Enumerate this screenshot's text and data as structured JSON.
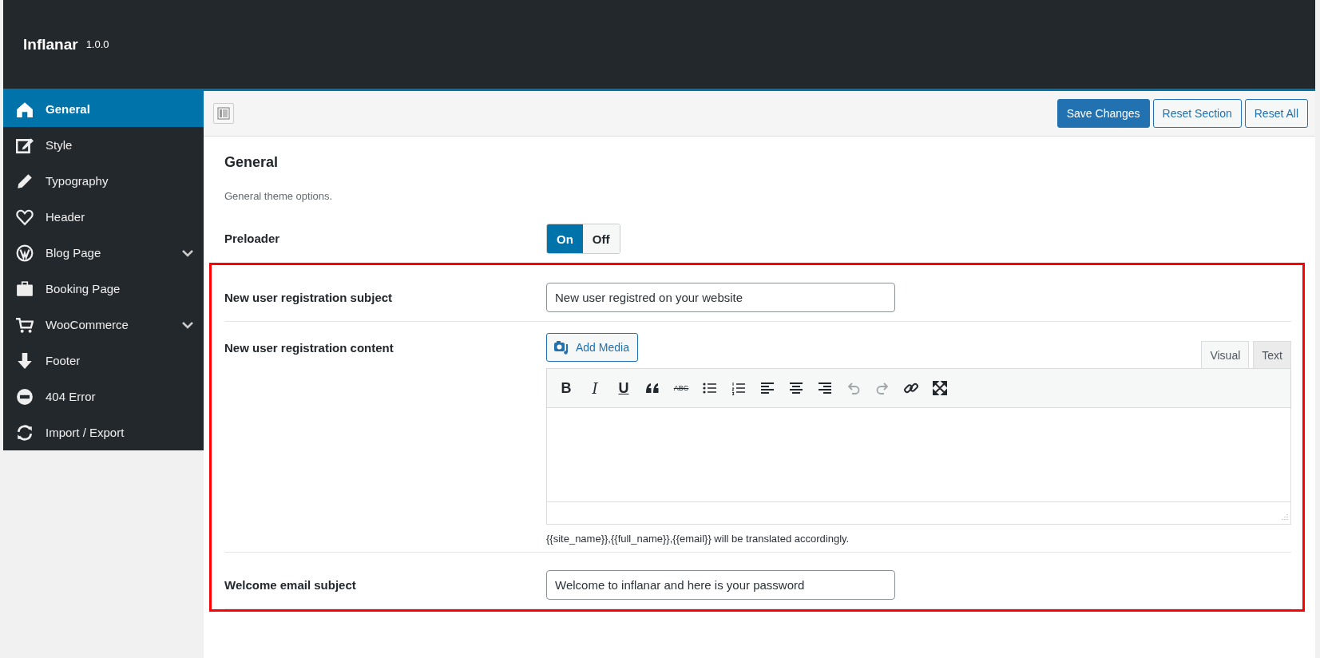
{
  "app": {
    "name": "Inflanar",
    "version": "1.0.0"
  },
  "sidebar": {
    "items": [
      {
        "label": "General",
        "selected": true,
        "has_submenu": false
      },
      {
        "label": "Style",
        "selected": false,
        "has_submenu": false
      },
      {
        "label": "Typography",
        "selected": false,
        "has_submenu": false
      },
      {
        "label": "Header",
        "selected": false,
        "has_submenu": false
      },
      {
        "label": "Blog Page",
        "selected": false,
        "has_submenu": true
      },
      {
        "label": "Booking Page",
        "selected": false,
        "has_submenu": false
      },
      {
        "label": "WooCommerce",
        "selected": false,
        "has_submenu": true
      },
      {
        "label": "Footer",
        "selected": false,
        "has_submenu": false
      },
      {
        "label": "404 Error",
        "selected": false,
        "has_submenu": false
      },
      {
        "label": "Import / Export",
        "selected": false,
        "has_submenu": false
      }
    ]
  },
  "toolbar": {
    "buttons": [
      {
        "label": "Save Changes",
        "primary": true
      },
      {
        "label": "Reset Section",
        "primary": false
      },
      {
        "label": "Reset All",
        "primary": false
      }
    ]
  },
  "section": {
    "title": "General",
    "description": "General theme options."
  },
  "fields": [
    {
      "kind": "toggle",
      "label": "Preloader",
      "options": [
        {
          "label": "On",
          "selected": true
        },
        {
          "label": "Off",
          "selected": false
        }
      ]
    }
  ],
  "highlighted_fields": [
    {
      "kind": "text",
      "label": "New user registration subject",
      "value": "New user registred on your website"
    },
    {
      "kind": "editor",
      "label": "New user registration content",
      "media_button": "Add Media",
      "tabs": [
        {
          "label": "Visual",
          "selected": true
        },
        {
          "label": "Text",
          "selected": false
        }
      ],
      "tools": [
        {
          "kind": "letter",
          "label": "B",
          "disabled": false
        },
        {
          "kind": "letter",
          "label": "I",
          "disabled": false
        },
        {
          "kind": "letter",
          "label": "U",
          "disabled": false
        },
        {
          "kind": "quote",
          "disabled": false
        },
        {
          "kind": "strike",
          "label": "ABC",
          "disabled": false
        },
        {
          "kind": "bullets",
          "disabled": false
        },
        {
          "kind": "numbers",
          "disabled": false
        },
        {
          "kind": "align-left",
          "disabled": false
        },
        {
          "kind": "align-center",
          "disabled": false
        },
        {
          "kind": "align-right",
          "disabled": false
        },
        {
          "kind": "undo",
          "disabled": true
        },
        {
          "kind": "redo",
          "disabled": true
        },
        {
          "kind": "link",
          "disabled": false
        },
        {
          "kind": "fullscreen",
          "disabled": false
        }
      ],
      "hint": "{{site_name}},{{full_name}},{{email}} will be translated accordingly."
    },
    {
      "kind": "text",
      "label": "Welcome email subject",
      "value": "Welcome to inflanar and here is your password"
    }
  ]
}
